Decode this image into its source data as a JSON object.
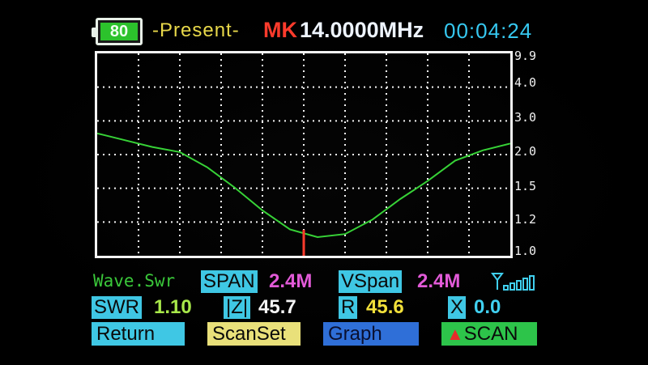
{
  "header": {
    "battery_level": "80",
    "mode": "-Present-",
    "marker_label": "MK",
    "frequency": "14.0000MHz",
    "clock": "00:04:24"
  },
  "chart_data": {
    "type": "line",
    "title": "",
    "xlabel": "",
    "ylabel": "",
    "y_tick_labels": [
      "9.9",
      "4.0",
      "3.0",
      "2.0",
      "1.5",
      "1.2",
      "1.0"
    ],
    "grid": true,
    "series": [
      {
        "values_swr": [
          2.6,
          2.4,
          2.2,
          2.05,
          1.8,
          1.5,
          1.3,
          1.15,
          1.1,
          1.12,
          1.22,
          1.4,
          1.6,
          1.9,
          2.1,
          2.3
        ]
      }
    ],
    "marker_position": "center"
  },
  "info": {
    "wave_label": "Wave.Swr",
    "span_label": "SPAN",
    "span_value": "2.4M",
    "vspan_label": "VSpan",
    "vspan_value": "2.4M",
    "swr_label": "SWR",
    "swr_value": "1.10",
    "z_label": "|Z|",
    "z_value": "45.7",
    "r_label": "R",
    "r_value": "45.6",
    "x_label": "X",
    "x_value": "0.0"
  },
  "buttons": {
    "return": "Return",
    "scanset": "ScanSet",
    "graph": "Graph",
    "scan": "SCAN",
    "scan_icon": "triangle-up-icon"
  },
  "colors": {
    "trace": "#37d237",
    "marker": "#ff3b2c",
    "grid": "#f4f4f4"
  }
}
